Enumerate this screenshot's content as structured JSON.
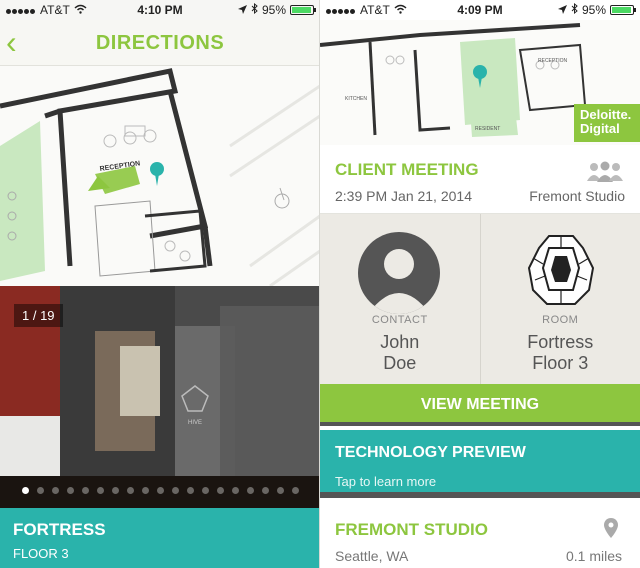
{
  "left": {
    "status": {
      "carrier": "AT&T",
      "time": "4:10 PM",
      "battery": "95%"
    },
    "nav": {
      "back": "‹",
      "title": "DIRECTIONS"
    },
    "map": {
      "reception_label": "RECEPTION"
    },
    "photo": {
      "counter": "1 / 19",
      "total": 19,
      "current": 1,
      "wall_text": "HIVE"
    },
    "location": {
      "name": "FORTRESS",
      "floor": "FLOOR 3"
    }
  },
  "right": {
    "status": {
      "carrier": "AT&T",
      "time": "4:09 PM",
      "battery": "95%"
    },
    "brand": {
      "line1": "Deloitte.",
      "line2": "Digital"
    },
    "map": {
      "labels": [
        "KITCHEN",
        "RECEPTION",
        "RESIDENT"
      ]
    },
    "meeting": {
      "title": "CLIENT MEETING",
      "time": "2:39 PM Jan 21, 2014",
      "location": "Fremont Studio"
    },
    "contact": {
      "caption": "CONTACT",
      "name_line1": "John",
      "name_line2": "Doe"
    },
    "room": {
      "caption": "ROOM",
      "line1": "Fortress",
      "line2": "Floor 3"
    },
    "view_button": "VIEW MEETING",
    "tech": {
      "title": "TECHNOLOGY PREVIEW",
      "subtitle": "Tap to learn more"
    },
    "studio": {
      "title": "FREMONT STUDIO",
      "city": "Seattle, WA",
      "distance": "0.1 miles"
    }
  },
  "colors": {
    "accent_green": "#8dc63f",
    "teal": "#2ab3ab",
    "dark_divider": "#555555"
  }
}
